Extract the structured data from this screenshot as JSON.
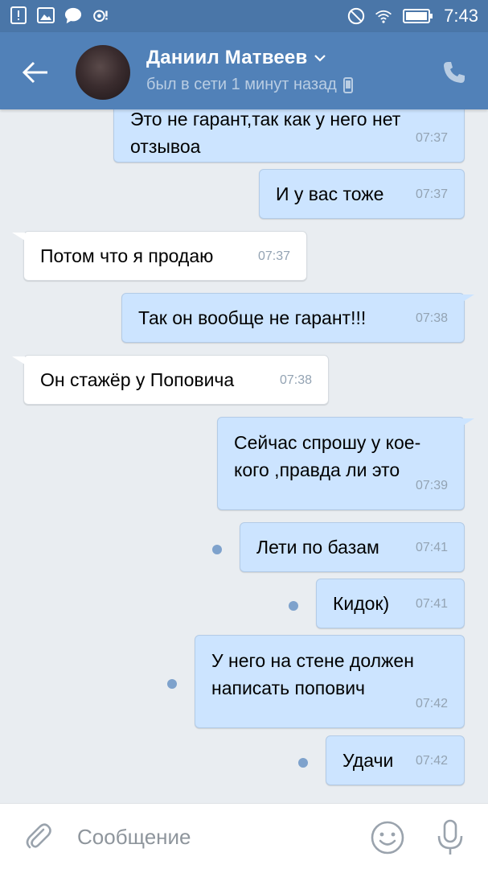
{
  "status_bar": {
    "time": "7:43"
  },
  "header": {
    "name": "Даниил Матвеев",
    "status": "был в сети 1 минут назад"
  },
  "messages": [
    {
      "dir": "out",
      "lines": [
        "Это не гарант,так как у него нет",
        "отзывоа"
      ],
      "time": "07:37",
      "unread": false
    },
    {
      "dir": "out",
      "lines": [
        "И у вас тоже"
      ],
      "time": "07:37",
      "unread": false
    },
    {
      "dir": "in",
      "lines": [
        "Потом что я продаю"
      ],
      "time": "07:37",
      "unread": false
    },
    {
      "dir": "out",
      "lines": [
        "Так он вообще не гарант!!!"
      ],
      "time": "07:38",
      "unread": false
    },
    {
      "dir": "in",
      "lines": [
        "Он стажёр у Поповича"
      ],
      "time": "07:38",
      "unread": false
    },
    {
      "dir": "out",
      "lines": [
        "Сейчас спрошу у кое-",
        "кого ,правда ли это"
      ],
      "time": "07:39",
      "unread": false
    },
    {
      "dir": "out",
      "lines": [
        "Лети по базам"
      ],
      "time": "07:41",
      "unread": true
    },
    {
      "dir": "out",
      "lines": [
        "Кидок)"
      ],
      "time": "07:41",
      "unread": true
    },
    {
      "dir": "out",
      "lines": [
        "У него на стене должен",
        "написать попович"
      ],
      "time": "07:42",
      "unread": true
    },
    {
      "dir": "out",
      "lines": [
        "Удачи"
      ],
      "time": "07:42",
      "unread": true
    }
  ],
  "composer": {
    "placeholder": "Сообщение"
  },
  "colors": {
    "header": "#5181b8",
    "status_bar": "#4a76a8",
    "outgoing": "#cce4ff",
    "incoming": "#ffffff",
    "background": "#e9edf1",
    "unread_dot": "#7ea2cc"
  },
  "icons": [
    "notification-icon",
    "image-icon",
    "chat-bubble-icon",
    "camera-icon",
    "dnd-icon",
    "wifi-icon",
    "battery-icon",
    "back-arrow-icon",
    "chevron-down-icon",
    "mobile-icon",
    "phone-icon",
    "paperclip-icon",
    "emoji-icon",
    "microphone-icon"
  ]
}
